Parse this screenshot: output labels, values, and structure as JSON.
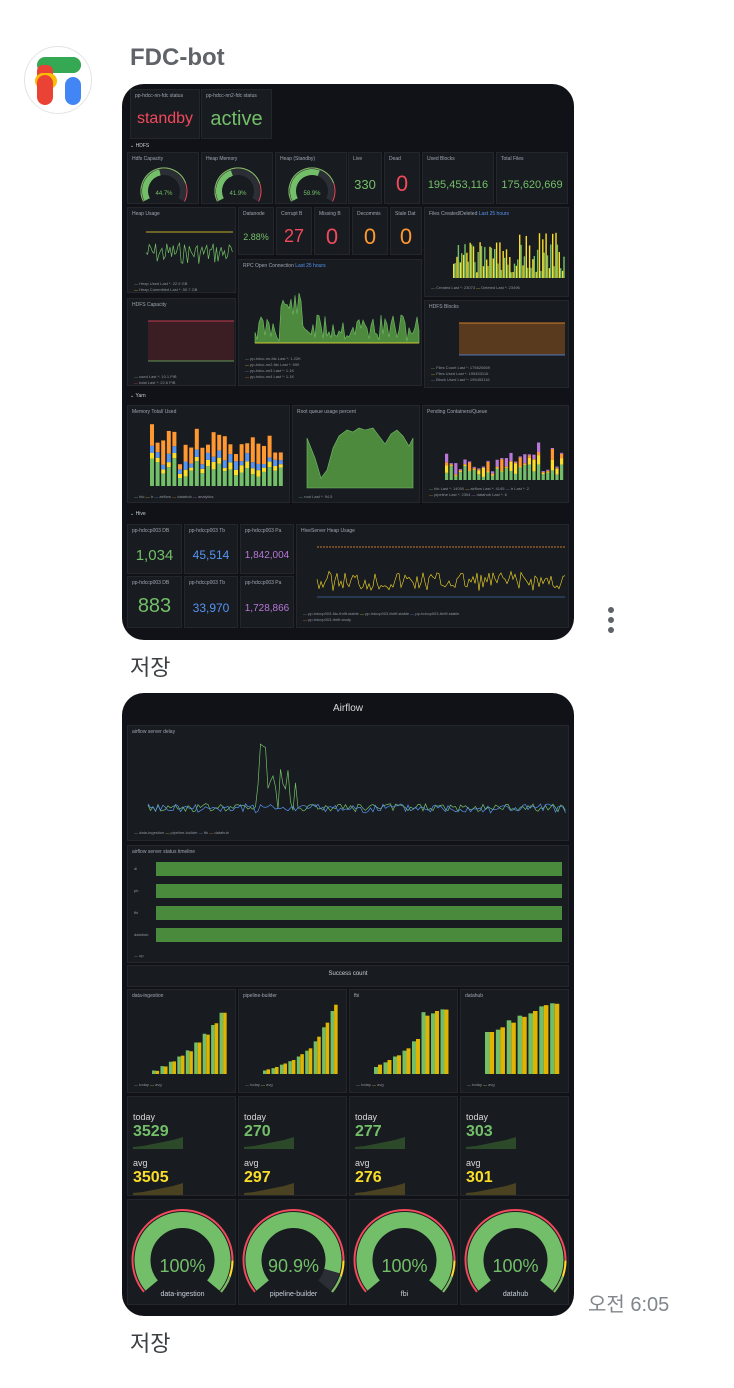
{
  "sender": {
    "name": "FDC-bot"
  },
  "save_label": "저장",
  "time": "오전 6:05",
  "dash1": {
    "status": [
      {
        "title": "pp-hdcc-nn-fdc status",
        "value": "standby",
        "color": "#f2495c"
      },
      {
        "title": "pp-hdcc-nn2-fdc status",
        "value": "active",
        "color": "#73bf69"
      }
    ],
    "rows": {
      "hdfs": "HDFS",
      "yarn": "Yarn",
      "hive": "Hive"
    },
    "gauges": [
      {
        "title": "Hdfs Capacity",
        "value": "44.7%",
        "fraction": 0.447
      },
      {
        "title": "Heap Memory",
        "value": "41.9%",
        "fraction": 0.419
      },
      {
        "title": "Heap (Standby)",
        "value": "58.9%",
        "fraction": 0.589
      }
    ],
    "counts": [
      {
        "title": "Live",
        "value": "330",
        "color": "#73bf69"
      },
      {
        "title": "Dead",
        "value": "0",
        "color": "#f2495c"
      },
      {
        "title": "Used Blocks",
        "value": "195,453,116",
        "color": "#73bf69"
      },
      {
        "title": "Total Files",
        "value": "175,620,669",
        "color": "#73bf69"
      }
    ],
    "heap_usage": {
      "title": "Heap Usage",
      "legend": [
        "Heap Used  Last *: 22.9 GB",
        "Heap Committed  Last *: 50.7 GB"
      ]
    },
    "node_stats": [
      {
        "title": "Datanode",
        "value": "2.88%",
        "color": "#73bf69"
      },
      {
        "title": "Corrupt B",
        "value": "27",
        "color": "#f2495c"
      },
      {
        "title": "Missing B",
        "value": "0",
        "color": "#f2495c"
      },
      {
        "title": "Decommis",
        "value": "0",
        "color": "#ff9830"
      },
      {
        "title": "Stale Dat",
        "value": "0",
        "color": "#ff9830"
      }
    ],
    "files_created": {
      "title": "Files Created/Deleted",
      "badge": "Last 25 hours",
      "legend": [
        "Created  Last *: 23073",
        "Deleted  Last *: 23496"
      ]
    },
    "rpc": {
      "title": "RPC Open Connection",
      "badge": "Last 25 hours",
      "legend": [
        "pp-hdcc-nn-fdc  Last *: 1.22K",
        "pp-hdcc-nn2-fdc  Last *: 590",
        "pp-hdcc-nn3  Last *: 1.1K",
        "pp-hdcc-nn4  Last *: 1.1K"
      ]
    },
    "hdfs_capacity": {
      "title": "HDFS Capacity",
      "legend": [
        "used  Last *: 10.1 PiB",
        "total  Last *: 22.6 PiB"
      ]
    },
    "hdfs_blocks": {
      "title": "HDFS Blocks",
      "legend": [
        "Files Count  Last *: 175620669",
        "Files Used  Last *: 195453116",
        "Block Used  Last *: 195453116"
      ]
    },
    "memory_total": {
      "title": "Memory Total/ Used",
      "legend": [
        "fdc",
        "tr",
        "airflow",
        "datahub",
        "analytics"
      ]
    },
    "root_queue": {
      "title": "Root queue usage percent",
      "legend": [
        "root  Last *: 94.5"
      ]
    },
    "pending": {
      "title": "Pending Containers/Queue",
      "legend": [
        "fdc  Last *: 14000",
        "airflow  Last *: 4145",
        "tr  Last *: 2",
        "pipeline  Last *: 2304",
        "datahub  Last *: 6"
      ]
    },
    "hive": [
      {
        "title": "pp-hdccp003 DB",
        "value": "1,034",
        "color": "#73bf69"
      },
      {
        "title": "pp-hdccp003 Tb",
        "value": "45,514",
        "color": "#5794f2"
      },
      {
        "title": "pp-hdccp003 Pa",
        "value": "1,842,004",
        "color": "#b877d9"
      },
      {
        "title": "pp-hdccp003 DB",
        "value": "883",
        "color": "#73bf69"
      },
      {
        "title": "pp-hdccp003 Tb",
        "value": "33,970",
        "color": "#5794f2"
      },
      {
        "title": "pp-hdccp003 Pa",
        "value": "1,728,866",
        "color": "#b877d9"
      }
    ],
    "metastore": {
      "title": "HiveServer Heap Usage",
      "legend": [
        "pp-hdccp003-fdc-thrift.stable",
        "pp-hdccp003-thrift.stable",
        "pp-hdccp003-thrift.stable",
        "pp-hdccp003-thrift.study"
      ]
    }
  },
  "dash2": {
    "title": "Airflow",
    "delay": {
      "title": "airflow server delay",
      "legend": [
        "data-ingestion",
        "pipeline-builder",
        "fbi",
        "datahub"
      ],
      "ymax": 7
    },
    "timeline": {
      "title": "airflow server status timeline",
      "rows": [
        "di",
        "pb",
        "fbi",
        "datahub"
      ],
      "legend": "up"
    },
    "success_title": "Success count",
    "bars": [
      {
        "title": "data-ingestion",
        "ymax": 4000,
        "today": [
          200,
          450,
          700,
          1000,
          1350,
          1800,
          2300,
          2800,
          3500
        ],
        "avg": [
          180,
          430,
          720,
          1050,
          1300,
          1800,
          2250,
          2900,
          3500
        ]
      },
      {
        "title": "pipeline-builder",
        "ymax": 300,
        "today": [
          15,
          25,
          40,
          55,
          75,
          100,
          140,
          200,
          270
        ],
        "avg": [
          20,
          30,
          45,
          60,
          85,
          110,
          160,
          220,
          297
        ]
      },
      {
        "title": "fbi",
        "ymax": 300,
        "today": [
          30,
          50,
          75,
          100,
          140,
          265,
          260,
          277
        ],
        "avg": [
          40,
          60,
          80,
          110,
          150,
          250,
          270,
          276
        ]
      },
      {
        "title": "datahub",
        "ymax": 300,
        "today": [
          180,
          190,
          230,
          250,
          260,
          290,
          303
        ],
        "avg": [
          180,
          200,
          220,
          245,
          270,
          295,
          301
        ]
      }
    ],
    "bar_legend": [
      "today",
      "avg"
    ],
    "stats": [
      {
        "today": "3529",
        "avg": "3505"
      },
      {
        "today": "270",
        "avg": "297"
      },
      {
        "today": "277",
        "avg": "276"
      },
      {
        "today": "303",
        "avg": "301"
      }
    ],
    "stat_labels": {
      "today": "today",
      "avg": "avg"
    },
    "gauges": [
      {
        "label": "data-ingestion",
        "value": "100%",
        "fraction": 1.0
      },
      {
        "label": "pipeline-builder",
        "value": "90.9%",
        "fraction": 0.909
      },
      {
        "label": "fbi",
        "value": "100%",
        "fraction": 1.0
      },
      {
        "label": "datahub",
        "value": "100%",
        "fraction": 1.0
      }
    ]
  },
  "colors": {
    "green": "#73bf69",
    "red": "#f2495c",
    "orange": "#ff9830",
    "yellow": "#fade2a",
    "blue": "#5794f2",
    "purple": "#b877d9",
    "panel": "#181b1f",
    "bg": "#111217"
  }
}
